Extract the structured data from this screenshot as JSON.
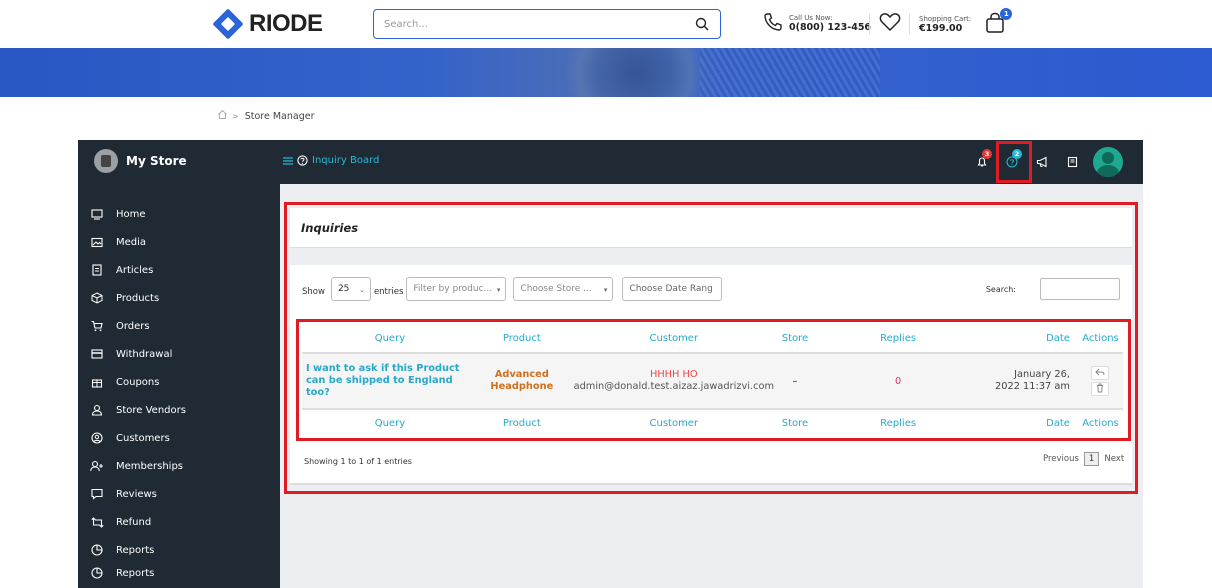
{
  "header": {
    "logo_text": "RIODE",
    "search_placeholder": "Search...",
    "call_label": "Call Us Now:",
    "call_number": "0(800) 123-456",
    "cart_label": "Shopping Cart:",
    "cart_total": "€199.00",
    "cart_count": "1"
  },
  "breadcrumb": {
    "current": "Store Manager"
  },
  "manager": {
    "store_name": "My Store",
    "page_link": "Inquiry Board",
    "notifications_count": "3",
    "inquiries_count": "2"
  },
  "sidebar": {
    "items": [
      {
        "label": "Home",
        "icon": "monitor-icon"
      },
      {
        "label": "Media",
        "icon": "image-icon"
      },
      {
        "label": "Articles",
        "icon": "document-icon"
      },
      {
        "label": "Products",
        "icon": "cube-icon"
      },
      {
        "label": "Orders",
        "icon": "cart-icon"
      },
      {
        "label": "Withdrawal",
        "icon": "card-icon"
      },
      {
        "label": "Coupons",
        "icon": "gift-icon"
      },
      {
        "label": "Store Vendors",
        "icon": "user-icon"
      },
      {
        "label": "Customers",
        "icon": "user-circle-icon"
      },
      {
        "label": "Memberships",
        "icon": "user-plus-icon"
      },
      {
        "label": "Reviews",
        "icon": "comment-icon"
      },
      {
        "label": "Refund",
        "icon": "retweet-icon"
      },
      {
        "label": "Reports",
        "icon": "pie-chart-icon"
      },
      {
        "label": "Reports",
        "icon": "pie-chart-icon"
      }
    ]
  },
  "inquiries": {
    "title": "Inquiries",
    "show_label": "Show",
    "entries_value": "25",
    "entries_label": "entries",
    "filter_product_placeholder": "Filter by produc...",
    "filter_store_placeholder": "Choose Store ...",
    "date_range_placeholder": "Choose Date Rang",
    "search_label": "Search:",
    "columns": [
      "Query",
      "Product",
      "Customer",
      "Store",
      "Replies",
      "Date",
      "Actions"
    ],
    "rows": [
      {
        "query": "I want to ask if this Product can be shipped to England too?",
        "product": "Advanced Headphone",
        "customer_name": "HHHH HO",
        "customer_email": "admin@donald.test.aizaz.jawadrizvi.com",
        "store": "–",
        "replies": "0",
        "date": "January 26, 2022 11:37 am"
      }
    ],
    "info": "Showing 1 to 1 of 1 entries",
    "pager": {
      "previous": "Previous",
      "page": "1",
      "next": "Next"
    }
  },
  "colors": {
    "brand_blue": "#2b64d8",
    "dark_panel": "#1f2a34",
    "link_teal": "#28a9c9",
    "highlight_red": "#e01b24"
  }
}
